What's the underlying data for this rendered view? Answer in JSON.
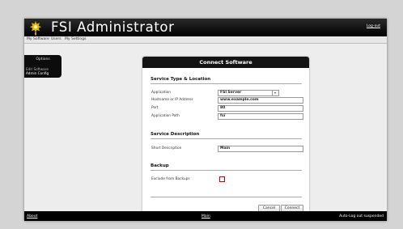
{
  "app": {
    "title": "FSI Administrator",
    "logout_label": "Log-out"
  },
  "menu": {
    "items": [
      "My Software",
      "Users",
      "My Settings"
    ]
  },
  "sidebar": {
    "title": "Options",
    "items": [
      {
        "label": "Edit Software",
        "color": "#b7b7b7"
      },
      {
        "label": "Admin Config",
        "color": "#ffffff"
      }
    ]
  },
  "card": {
    "title": "Connect Software",
    "sections": {
      "service": {
        "title": "Service Type & Location",
        "fields": [
          {
            "label": "Application",
            "value": "FSI Server"
          },
          {
            "label": "Hostname or IP Address",
            "value": "www.example.com"
          },
          {
            "label": "Port",
            "value": "80"
          },
          {
            "label": "Application Path",
            "value": "fsi"
          }
        ]
      },
      "description": {
        "title": "Service Description",
        "fields": [
          {
            "label": "Short Description",
            "value": "Main"
          }
        ]
      },
      "backup": {
        "title": "Backup",
        "fields": [
          {
            "label": "Exclude from Backups",
            "checked": false
          }
        ]
      }
    },
    "buttons": {
      "cancel": "Cancel",
      "connect": "Connect"
    }
  },
  "footer": {
    "left": "About",
    "center": "Main",
    "right": "Auto-Log out suspended"
  },
  "colors": {
    "accent": "#c00000",
    "header": "#141414",
    "logo": "#e6b800"
  },
  "icons": {
    "logo": "star-gear-icon",
    "select": "chevron-down-icon"
  }
}
